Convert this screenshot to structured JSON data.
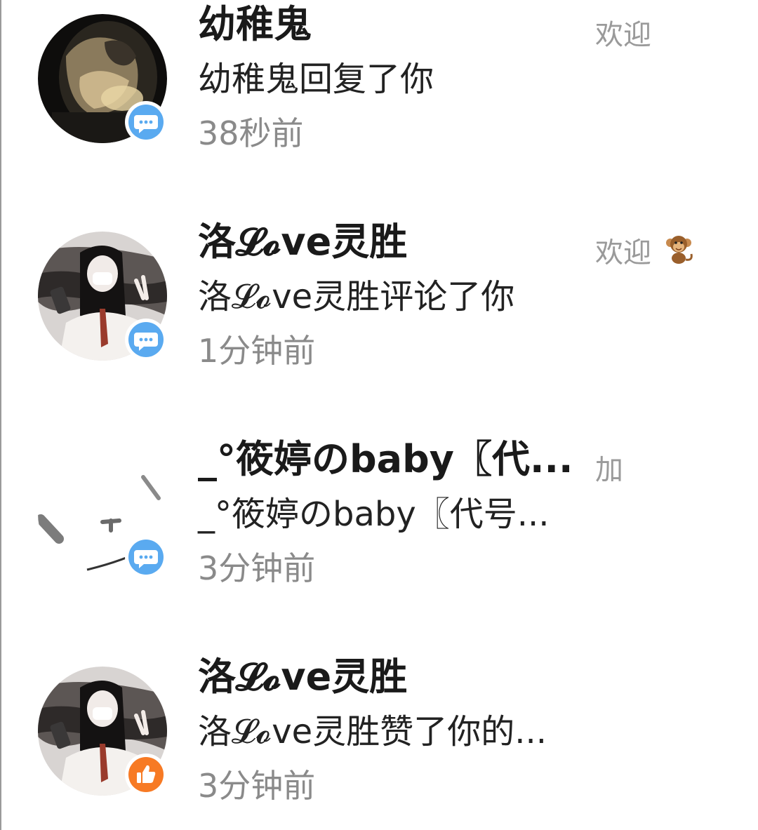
{
  "notifications": [
    {
      "name": "幼稚鬼",
      "message": "幼稚鬼回复了你",
      "time": "38秒前",
      "side_text": "欢迎",
      "badge": "comment-icon",
      "badge_color": "#5aaaf0"
    },
    {
      "name": "洛𝓛𝓸ve灵胜",
      "message": "洛𝓛𝓸ve灵胜评论了你",
      "time": "1分钟前",
      "side_text": "欢迎",
      "side_emoji": "monkey-icon",
      "badge": "comment-icon",
      "badge_color": "#5aaaf0"
    },
    {
      "name": "_°筱婷のbaby〖代...",
      "message": "_°筱婷のbaby〖代号...",
      "time": "3分钟前",
      "side_text": "加",
      "badge": "comment-icon",
      "badge_color": "#5aaaf0"
    },
    {
      "name": "洛𝓛𝓸ve灵胜",
      "message": "洛𝓛𝓸ve灵胜赞了你的...",
      "time": "3分钟前",
      "badge": "thumbs-up-icon",
      "badge_color": "#f77a24"
    }
  ]
}
